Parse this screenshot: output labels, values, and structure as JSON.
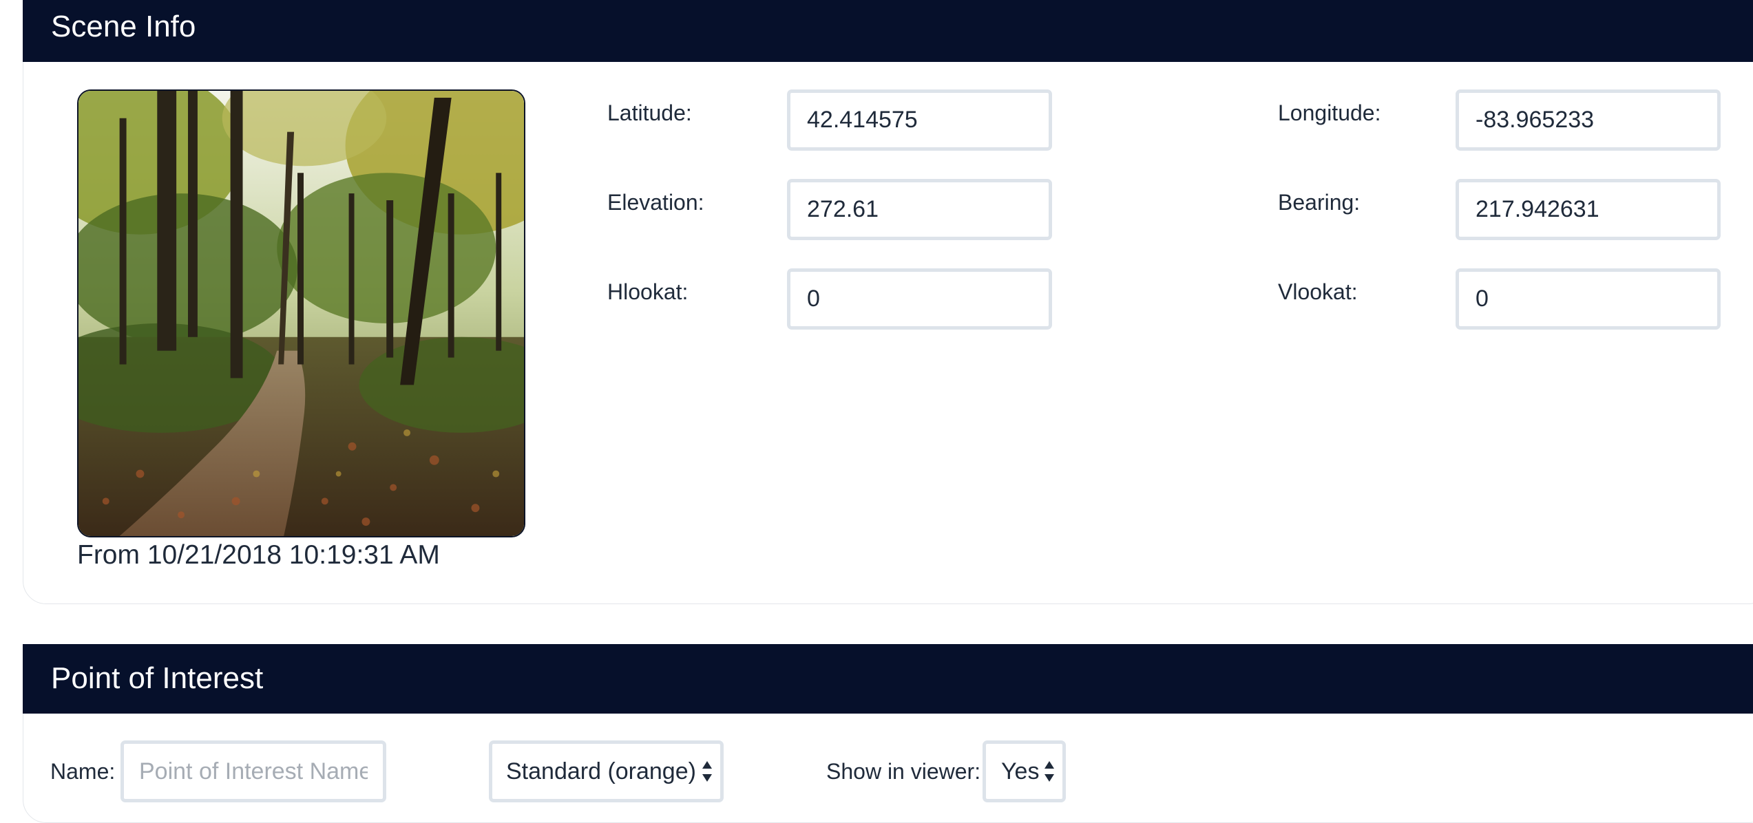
{
  "scene_info": {
    "title": "Scene Info",
    "image_alt": "Forest trail with autumn foliage",
    "caption": "From 10/21/2018 10:19:31 AM",
    "fields": {
      "latitude": {
        "label": "Latitude:",
        "value": "42.414575"
      },
      "longitude": {
        "label": "Longitude:",
        "value": "-83.965233"
      },
      "elevation": {
        "label": "Elevation:",
        "value": "272.61"
      },
      "bearing": {
        "label": "Bearing:",
        "value": "217.942631"
      },
      "hlookat": {
        "label": "Hlookat:",
        "value": "0"
      },
      "vlookat": {
        "label": "Vlookat:",
        "value": "0"
      }
    }
  },
  "point_of_interest": {
    "title": "Point of Interest",
    "name_label": "Name:",
    "name_placeholder": "Point of Interest Name",
    "name_value": "",
    "style_select": {
      "selected": "Standard (orange)"
    },
    "show_in_viewer_label": "Show in viewer:",
    "show_in_viewer_select": {
      "selected": "Yes"
    }
  },
  "colors": {
    "header_bg": "#06102b",
    "header_text": "#ffffff",
    "input_border": "#dde3ea",
    "text": "#1f2a3a",
    "placeholder": "#a6acb4"
  }
}
